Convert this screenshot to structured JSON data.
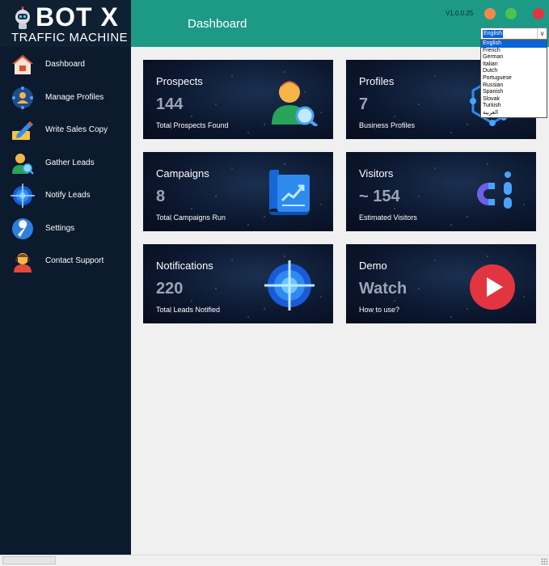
{
  "brand": {
    "title": "BOT X",
    "subtitle": "TRAFFIC MACHINE"
  },
  "sidebar": {
    "items": [
      {
        "label": "Dashboard",
        "icon": "home-icon"
      },
      {
        "label": "Manage Profiles",
        "icon": "profiles-icon"
      },
      {
        "label": "Write Sales Copy",
        "icon": "pen-icon"
      },
      {
        "label": "Gather Leads",
        "icon": "user-search-icon"
      },
      {
        "label": "Notify Leads",
        "icon": "target-icon"
      },
      {
        "label": "Settings",
        "icon": "wrench-icon"
      },
      {
        "label": "Contact Support",
        "icon": "support-agent-icon"
      }
    ]
  },
  "header": {
    "title": "Dashboard",
    "version": "V1.0.0.25"
  },
  "language": {
    "selected": "English",
    "options": [
      "English",
      "French",
      "German",
      "Italian",
      "Dutch",
      "Portuguese",
      "Russian",
      "Spanish",
      "Slovak",
      "Turkish",
      "العربية"
    ]
  },
  "cards": [
    {
      "title": "Prospects",
      "value": "144",
      "sub": "Total Prospects Found",
      "icon": "user-search-icon"
    },
    {
      "title": "Profiles",
      "value": "7",
      "sub": "Business Profiles",
      "icon": "network-icon"
    },
    {
      "title": "Campaigns",
      "value": "8",
      "sub": "Total Campaigns Run",
      "icon": "map-chart-icon"
    },
    {
      "title": "Visitors",
      "value": "~ 154",
      "sub": "Estimated Visitors",
      "icon": "magnet-icon"
    },
    {
      "title": "Notifications",
      "value": "220",
      "sub": "Total Leads Notified",
      "icon": "target-icon"
    },
    {
      "title": "Demo",
      "value": "Watch",
      "sub": "How to use?",
      "icon": "play-icon"
    }
  ],
  "colors": {
    "sidebar": "#0b1a2c",
    "header": "#1d9a86",
    "minimize": "#f08a4a",
    "maximize": "#4cc44c",
    "close": "#e2353f",
    "selection": "#0a64d8"
  }
}
